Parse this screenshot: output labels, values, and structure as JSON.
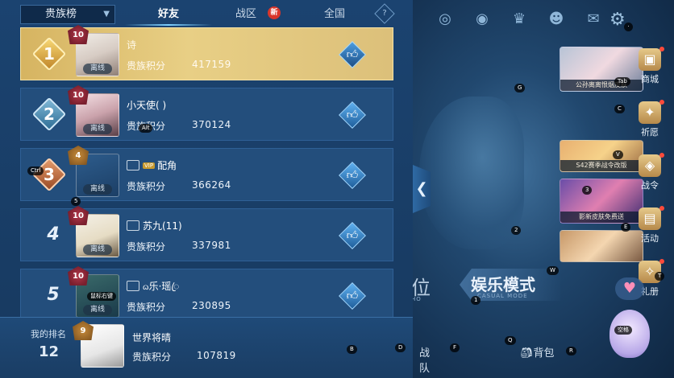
{
  "scene": {
    "mode_left": "位",
    "mode_left_sub": "HO",
    "mode_right": "娱乐模式",
    "mode_right_sub": "CASUAL MODE",
    "bottom_team": "战队",
    "bottom_bag": "背包",
    "side_items": [
      {
        "label": "商城",
        "icon": "shop-icon"
      },
      {
        "label": "祈愿",
        "icon": "wish-icon"
      },
      {
        "label": "战令",
        "icon": "battlepass-icon"
      },
      {
        "label": "活动",
        "icon": "event-icon"
      },
      {
        "label": "礼册",
        "icon": "gift-book-icon"
      }
    ],
    "banners": [
      {
        "caption": "公孙离离恨烟皮肤"
      },
      {
        "caption": "S42赛季战令改版"
      },
      {
        "caption": "影新皮肤免费送"
      },
      {
        "caption": ""
      }
    ],
    "top_icons": [
      "target-icon",
      "eye-icon",
      "trophy-icon",
      "friends-icon",
      "mail-icon",
      "gear-icon"
    ],
    "key_hints": {
      "tab": "Tab",
      "g": "G",
      "c": "C",
      "v": "V",
      "three": "3",
      "e": "E",
      "two": "2",
      "w": "W",
      "t": "T",
      "one": "1",
      "b": "B",
      "d": "D",
      "f": "F",
      "q": "Q",
      "r": "R",
      "space": "空格",
      "dot": "·"
    }
  },
  "panel": {
    "dropdown_label": "贵族榜",
    "tabs": [
      {
        "label": "好友",
        "active": true
      },
      {
        "label": "战区",
        "active": false,
        "badge": "新"
      },
      {
        "label": "全国",
        "active": false
      }
    ],
    "help_label": "?",
    "score_label": "贵族积分",
    "offline_label": "离线",
    "rows": [
      {
        "rank": "1",
        "level": "10",
        "name": "诗",
        "score": "417159",
        "has_title": false
      },
      {
        "rank": "2",
        "level": "10",
        "name": "小天使( )",
        "score": "370124",
        "has_title": false
      },
      {
        "rank": "3",
        "level": "4",
        "name": "配角",
        "score": "366264",
        "has_title": true,
        "vip": "VIP"
      },
      {
        "rank": "4",
        "level": "10",
        "name": "苏九(11)",
        "score": "337981",
        "has_title": true
      },
      {
        "rank": "5",
        "level": "10",
        "name": "ᦒ乐·瑶ꦿ",
        "score": "230895",
        "has_title": true
      }
    ],
    "row_key_hints": {
      "alt": "Alt",
      "ctrl": "Ctrl",
      "five": "5",
      "mouse_right": "鼠标右键"
    },
    "my_rank": {
      "label": "我的排名",
      "rank": "12",
      "level": "9",
      "name": "世界将晴",
      "score": "107819"
    }
  },
  "colors": {
    "accent": "#7fd0ff",
    "first_row_gold": "#dcc07a",
    "row_bg": "#234e7c",
    "new_badge": "#d9362b"
  }
}
